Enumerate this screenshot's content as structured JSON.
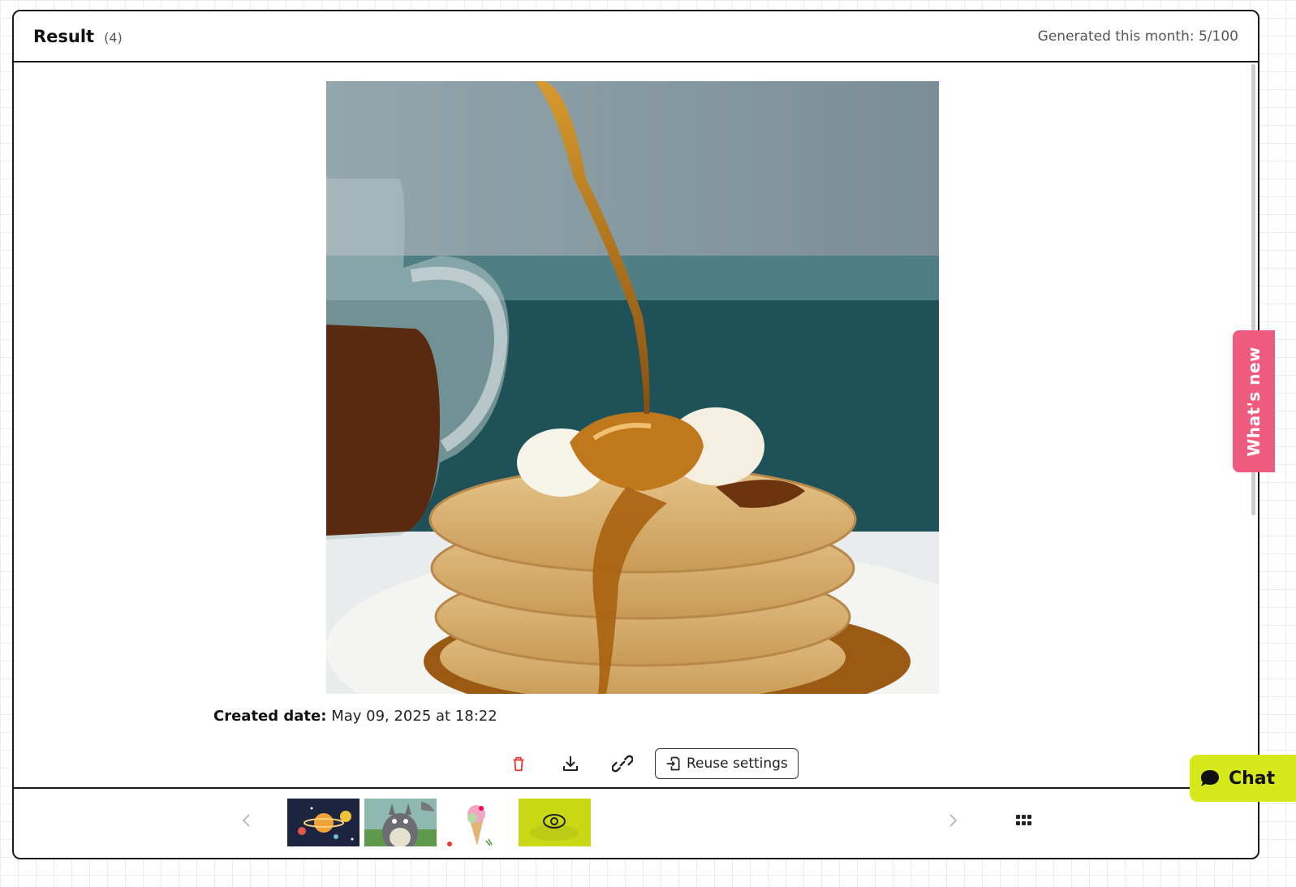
{
  "header": {
    "title": "Result",
    "count": "(4)",
    "usage": "Generated this month: 5/100"
  },
  "main_image": {
    "icon": "pancakes-syrup-image"
  },
  "meta": {
    "created_label": "Created date:",
    "created_value": "May 09, 2025 at 18:22"
  },
  "actions": {
    "reuse_label": "Reuse settings"
  },
  "thumbnails": [
    {
      "icon": "planets-thumbnail"
    },
    {
      "icon": "totoro-thumbnail"
    },
    {
      "icon": "ice-cream-thumbnail"
    },
    {
      "icon": "pancakes-thumbnail-selected"
    }
  ],
  "side_tab": {
    "label": "What's new"
  },
  "chat": {
    "label": "Chat"
  },
  "colors": {
    "whats_new_bg": "#ef5b7f",
    "chat_bg": "#d5e91a",
    "delete_red": "#e53935",
    "selected_thumb": "#c9d915"
  }
}
